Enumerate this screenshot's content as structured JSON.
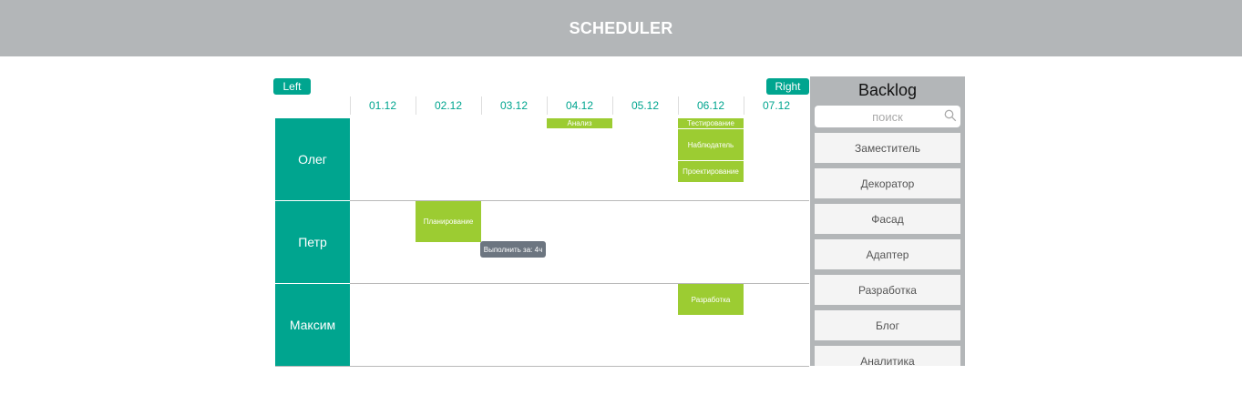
{
  "header": {
    "title": "SCHEDULER"
  },
  "nav": {
    "left_label": "Left",
    "right_label": "Right"
  },
  "dates": [
    "01.12",
    "02.12",
    "03.12",
    "04.12",
    "05.12",
    "06.12",
    "07.12"
  ],
  "people": [
    "Олег",
    "Петр",
    "Максим"
  ],
  "tasks": {
    "oleg_analysis": "Анализ",
    "oleg_testing": "Тестирование",
    "oleg_observer": "Наблюдатель",
    "oleg_design": "Проектирование",
    "petr_planning": "Планирование",
    "maxim_dev": "Разработка"
  },
  "tooltip": "Выполнить за: 4ч",
  "backlog": {
    "title": "Backlog",
    "search_placeholder": "поиск",
    "items": [
      "Заместитель",
      "Декоратор",
      "Фасад",
      "Адаптер",
      "Разработка",
      "Блог",
      "Аналитика"
    ]
  },
  "colors": {
    "header_bg": "#b3b6b8",
    "accent": "#00a58f",
    "task": "#9ccc32",
    "tooltip": "#6c7580"
  }
}
